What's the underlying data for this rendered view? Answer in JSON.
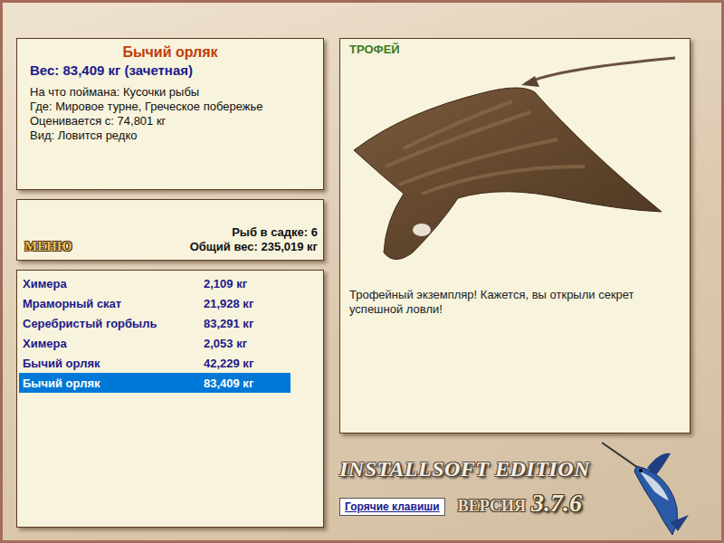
{
  "info": {
    "title": "Бычий орляк",
    "weight": "Вес: 83,409 кг (зачетная)",
    "lines": [
      "На что поймана: Кусочки рыбы",
      "Где: Мировое турне, Греческое побережье",
      "Оценивается с: 74,801 кг",
      "Вид: Ловится редко"
    ]
  },
  "menu_button": "МЕНЮ",
  "keepnet": {
    "count": "Рыб в садке: 6",
    "total": "Общий вес: 235,019 кг"
  },
  "catch_list": [
    {
      "name": "Химера",
      "weight": "2,109 кг",
      "selected": false
    },
    {
      "name": "Мраморный скат",
      "weight": "21,928 кг",
      "selected": false
    },
    {
      "name": "Серебристый горбыль",
      "weight": "83,291 кг",
      "selected": false
    },
    {
      "name": "Химера",
      "weight": "2,053 кг",
      "selected": false
    },
    {
      "name": "Бычий орляк",
      "weight": "42,229 кг",
      "selected": false
    },
    {
      "name": "Бычий орляк",
      "weight": "83,409 кг",
      "selected": true
    }
  ],
  "trophy": {
    "label": "ТРОФЕЙ",
    "message": "Трофейный экземпляр! Кажется, вы открыли секрет успешной ловли!"
  },
  "footer": {
    "edition": "INSTALLSOFT EDITION",
    "version_label": "ВЕРСИЯ",
    "version": "3.7.6",
    "hotkeys_button": "Горячие клавиши"
  }
}
